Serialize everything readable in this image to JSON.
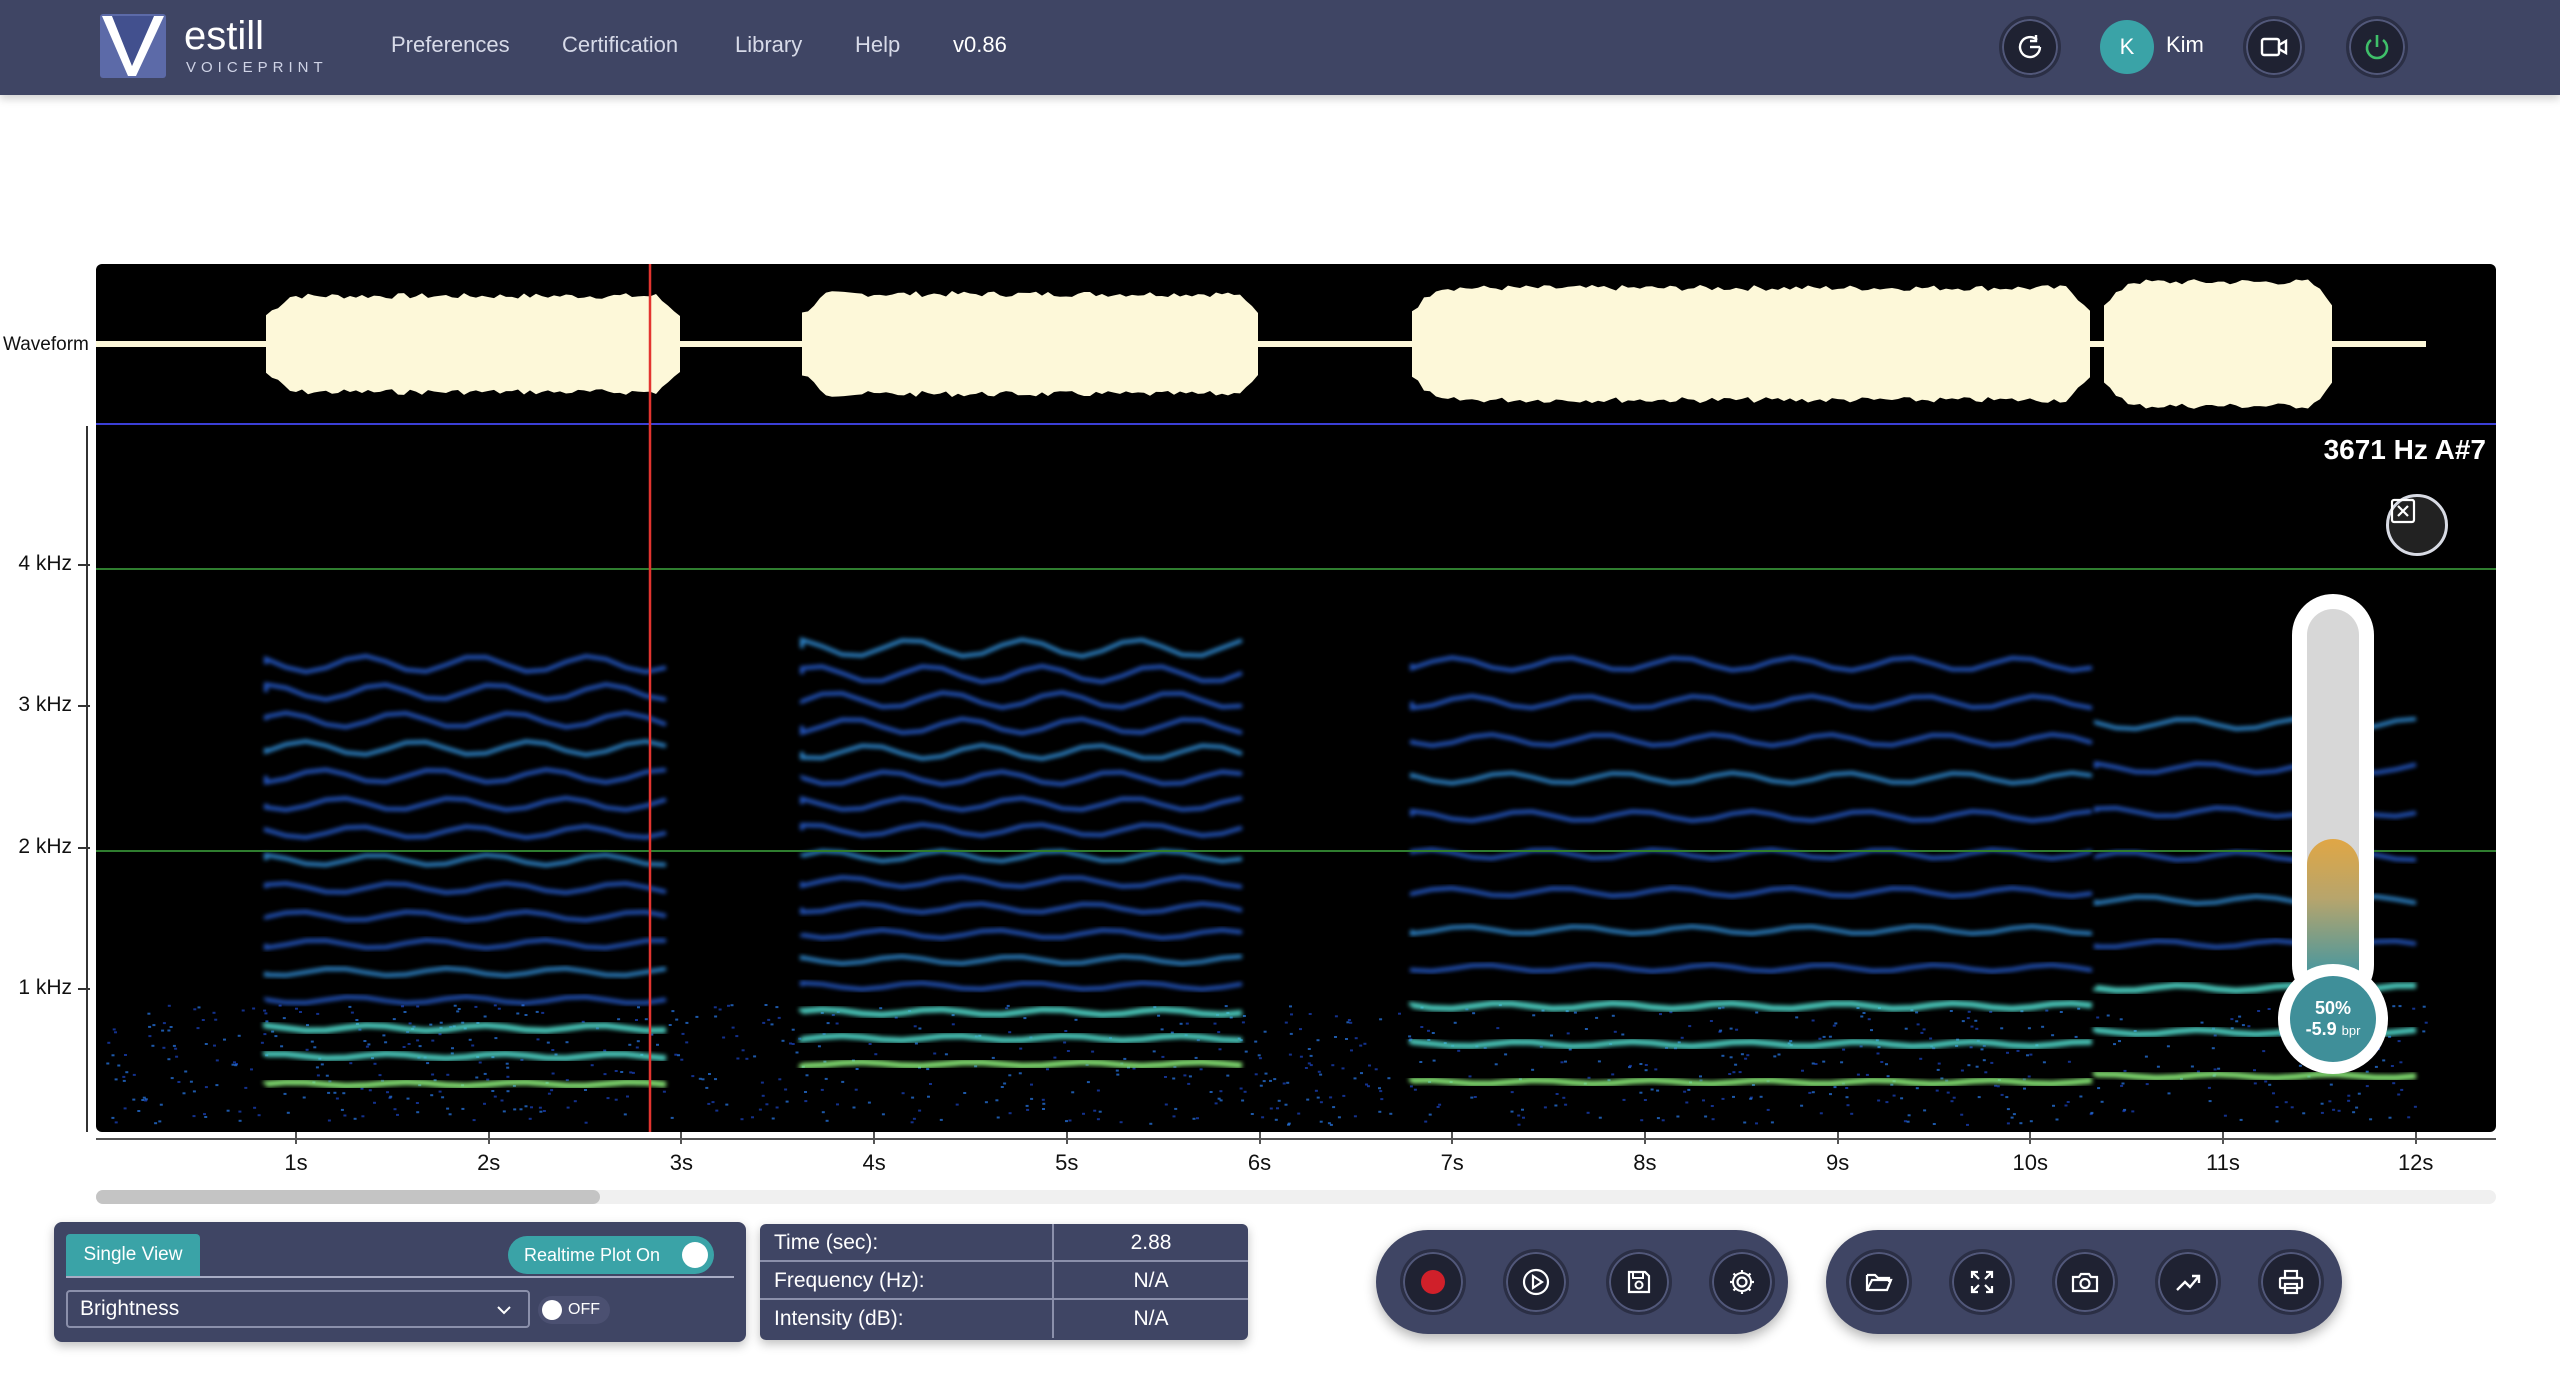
{
  "app": {
    "logo_word": "estill",
    "logo_sub": "VOICEPRINT",
    "nav": {
      "preferences": "Preferences",
      "certification": "Certification",
      "library": "Library",
      "help": "Help",
      "version": "v0.86"
    },
    "user": {
      "initial": "K",
      "name": "Kim"
    }
  },
  "plot": {
    "waveform_label": "Waveform",
    "freq_ticks": [
      "4 kHz",
      "3 kHz",
      "2 kHz",
      "1 kHz"
    ],
    "time_ticks": [
      "1s",
      "2s",
      "3s",
      "4s",
      "5s",
      "6s",
      "7s",
      "8s",
      "9s",
      "10s",
      "11s",
      "12s"
    ],
    "hz_readout": "3671 Hz A#7",
    "gauge": {
      "percent_value": 50,
      "percent": "50%",
      "value": "-5.9",
      "unit": "bpr"
    },
    "scroll_fraction": 0.21
  },
  "view_panel": {
    "tab": "Single View",
    "realtime": "Realtime Plot On",
    "select_value": "Brightness",
    "off_label": "OFF"
  },
  "info": {
    "rows": [
      {
        "key": "Time (sec):",
        "value": "2.88"
      },
      {
        "key": "Frequency (Hz):",
        "value": "N/A"
      },
      {
        "key": "Intensity (dB):",
        "value": "N/A"
      }
    ]
  },
  "colors": {
    "nav_bg": "#3f4564",
    "accent": "#3aa3a7",
    "waveform": "#fdf8d9",
    "cursor": "#e3342f",
    "record": "#d0202a"
  },
  "icons": {
    "controls_left": [
      "record-icon",
      "play-icon",
      "save-icon",
      "settings-icon"
    ],
    "controls_right": [
      "folder-open-icon",
      "fullscreen-icon",
      "camera-icon",
      "trend-icon",
      "print-icon"
    ]
  }
}
